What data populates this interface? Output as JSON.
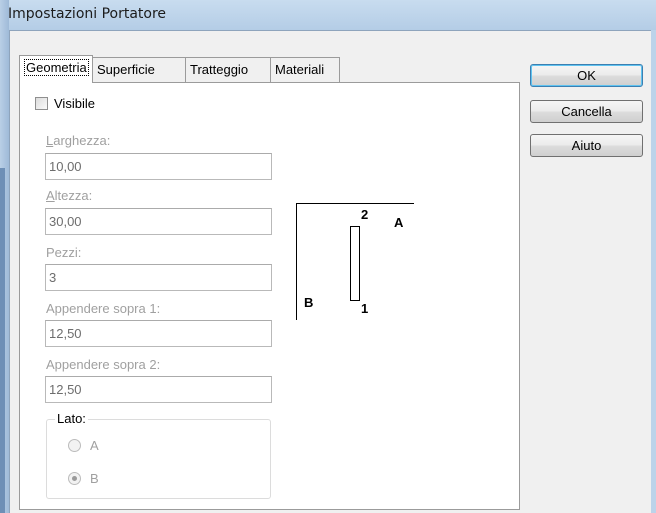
{
  "window": {
    "title": "Impostazioni Portatore"
  },
  "tabs": [
    {
      "label": "Geometria",
      "active": true
    },
    {
      "label": "Superficie",
      "active": false
    },
    {
      "label": "Tratteggio",
      "active": false
    },
    {
      "label": "Materiali",
      "active": false
    }
  ],
  "buttons": {
    "ok": "OK",
    "cancel": "Cancella",
    "help": "Aiuto"
  },
  "geometry": {
    "visible": {
      "label": "Visibile",
      "checked": false
    },
    "width": {
      "label": "Larghezza:",
      "value": "10,00"
    },
    "height": {
      "label": "Altezza:",
      "value": "30,00"
    },
    "pieces": {
      "label": "Pezzi:",
      "value": "3"
    },
    "hang1": {
      "label": "Appendere sopra 1:",
      "value": "12,50"
    },
    "hang2": {
      "label": "Appendere sopra 2:",
      "value": "12,50"
    },
    "side": {
      "label": "Lato:",
      "options": [
        {
          "label": "A",
          "checked": false
        },
        {
          "label": "B",
          "checked": true
        }
      ]
    }
  },
  "diagram": {
    "label_2": "2",
    "label_a": "A",
    "label_b": "B",
    "label_1": "1"
  }
}
